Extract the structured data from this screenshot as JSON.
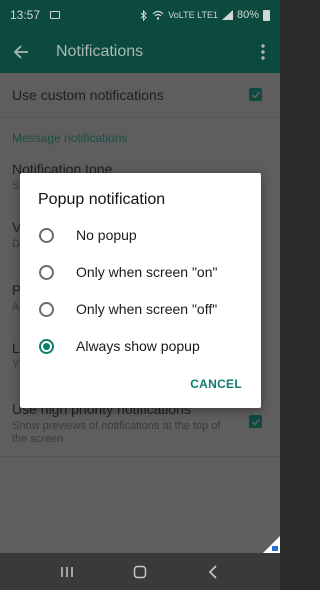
{
  "status_bar": {
    "time": "13:57",
    "network": "VoLTE LTE1",
    "battery": "80%",
    "icons": [
      "image-icon",
      "bluetooth-icon",
      "wifi-icon",
      "signal-icon",
      "battery-icon"
    ]
  },
  "app_bar": {
    "title": "Notifications",
    "icons": [
      "back-arrow-icon",
      "more-vert-icon"
    ]
  },
  "settings": {
    "use_custom": {
      "title": "Use custom notifications",
      "checked": true
    },
    "section_header": "Message notifications",
    "tone": {
      "title": "Notification tone",
      "sub": "S"
    },
    "vibrate": {
      "title": "V",
      "sub": "D"
    },
    "popup": {
      "title": "P",
      "sub": "A"
    },
    "light": {
      "title": "L",
      "sub": "Y"
    },
    "high_priority": {
      "title": "Use high priority notifications",
      "sub": "Show previews of notifications at the top of the screen",
      "checked": true
    }
  },
  "dialog": {
    "title": "Popup notification",
    "options": [
      {
        "label": "No popup",
        "selected": false
      },
      {
        "label": "Only when screen \"on\"",
        "selected": false
      },
      {
        "label": "Only when screen \"off\"",
        "selected": false
      },
      {
        "label": "Always show popup",
        "selected": true
      }
    ],
    "cancel_label": "CANCEL"
  },
  "nav_bar": {
    "icons": [
      "recents-icon",
      "home-icon",
      "back-icon"
    ]
  },
  "colors": {
    "accent": "#0e7d69",
    "app_bar": "#0c4a3f",
    "scrim_background": "#5e5e5e"
  }
}
